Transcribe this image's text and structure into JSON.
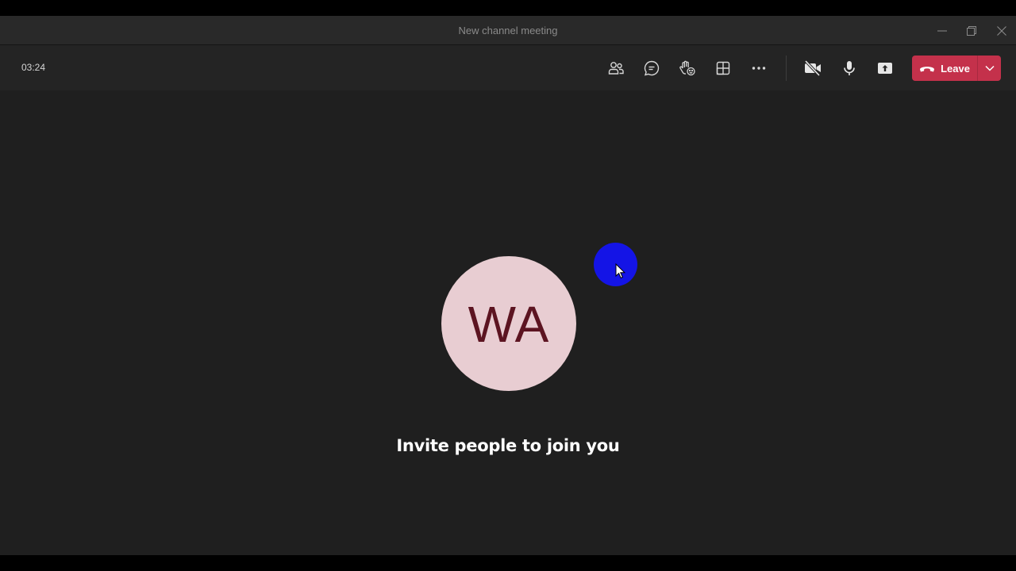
{
  "window": {
    "title": "New channel meeting"
  },
  "toolbar": {
    "timer": "03:24",
    "buttons": [
      {
        "name": "people",
        "icon": "people-icon"
      },
      {
        "name": "chat",
        "icon": "chat-icon"
      },
      {
        "name": "reactions",
        "icon": "raise-hand-icon"
      },
      {
        "name": "rooms",
        "icon": "breakout-rooms-icon"
      },
      {
        "name": "more",
        "icon": "more-icon"
      },
      {
        "name": "camera",
        "icon": "camera-off-icon"
      },
      {
        "name": "mic",
        "icon": "microphone-icon"
      },
      {
        "name": "share",
        "icon": "share-screen-icon"
      }
    ],
    "leave_label": "Leave"
  },
  "stage": {
    "avatar_initials": "WA",
    "invite_text": "Invite people to join you"
  },
  "colors": {
    "leave": "#c4314b",
    "avatar_bg": "#e8cdd2",
    "avatar_text": "#5c1421",
    "cursor_highlight": "#1414e6"
  }
}
